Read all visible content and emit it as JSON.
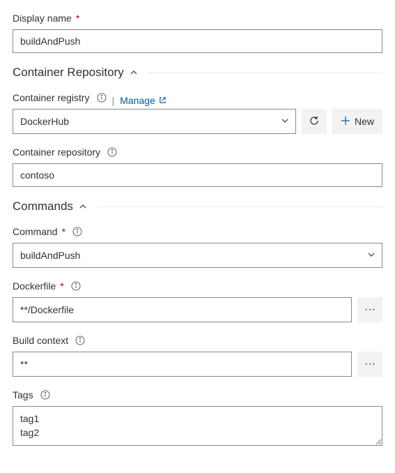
{
  "displayName": {
    "label": "Display name",
    "value": "buildAndPush"
  },
  "sections": {
    "containerRepository": {
      "title": "Container Repository"
    },
    "commands": {
      "title": "Commands"
    }
  },
  "containerRegistry": {
    "label": "Container registry",
    "manageLink": "Manage",
    "value": "DockerHub",
    "newButton": "New"
  },
  "containerRepository": {
    "label": "Container repository",
    "value": "contoso"
  },
  "command": {
    "label": "Command",
    "value": "buildAndPush"
  },
  "dockerfile": {
    "label": "Dockerfile",
    "value": "**/Dockerfile"
  },
  "buildContext": {
    "label": "Build context",
    "value": "**"
  },
  "tags": {
    "label": "Tags",
    "value": "tag1\ntag2"
  },
  "moreButtonLabel": "···"
}
